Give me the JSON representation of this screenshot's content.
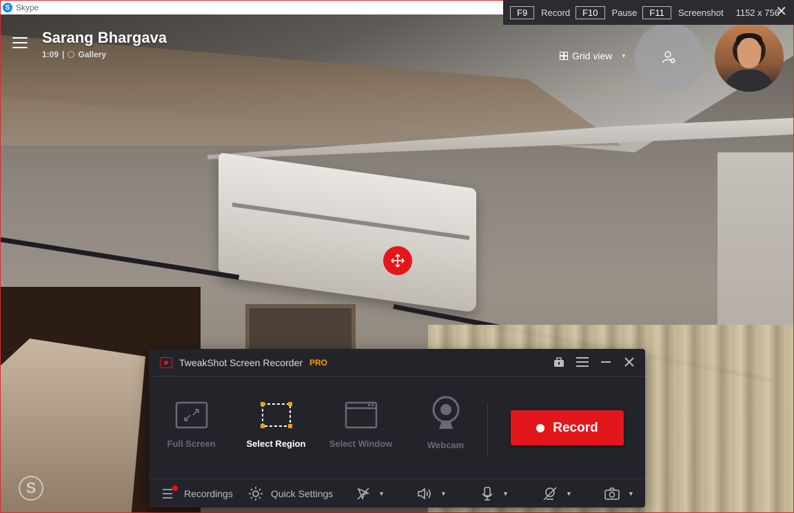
{
  "app": {
    "title": "Skype"
  },
  "call": {
    "callee_name": "Sarang Bhargava",
    "duration": "1:09",
    "separator": "|",
    "layout_label": "Gallery",
    "view_mode": "Grid view"
  },
  "hotkeys": {
    "record_key": "F9",
    "record_label": "Record",
    "pause_key": "F10",
    "pause_label": "Pause",
    "screenshot_key": "F11",
    "screenshot_label": "Screenshot",
    "size": "1152 x 756"
  },
  "recorder": {
    "title": "TweakShot Screen Recorder",
    "edition": "PRO",
    "modes": [
      "Full Screen",
      "Select Region",
      "Select Window",
      "Webcam"
    ],
    "active_mode": "Select Region",
    "record_label": "Record",
    "footer": {
      "recordings": "Recordings",
      "quick_settings": "Quick Settings"
    }
  },
  "colors": {
    "accent_red": "#e3161b",
    "pro_orange": "#f39c12",
    "panel_bg": "#23242a"
  }
}
